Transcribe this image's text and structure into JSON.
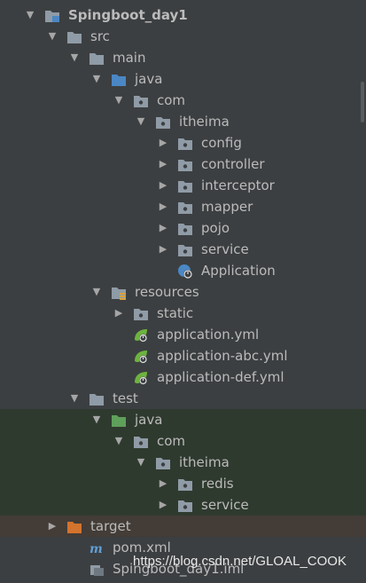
{
  "tree": [
    {
      "label": "Spingboot_day1",
      "icon": "module-folder-icon",
      "arrow": "expanded",
      "depth": 0,
      "bold": true
    },
    {
      "label": "src",
      "icon": "folder-icon",
      "arrow": "expanded",
      "depth": 1
    },
    {
      "label": "main",
      "icon": "folder-icon",
      "arrow": "expanded",
      "depth": 2
    },
    {
      "label": "java",
      "icon": "source-folder-icon",
      "arrow": "expanded",
      "depth": 3
    },
    {
      "label": "com",
      "icon": "package-icon",
      "arrow": "expanded",
      "depth": 4
    },
    {
      "label": "itheima",
      "icon": "package-icon",
      "arrow": "expanded",
      "depth": 5
    },
    {
      "label": "config",
      "icon": "package-icon",
      "arrow": "collapsed",
      "depth": 6
    },
    {
      "label": "controller",
      "icon": "package-icon",
      "arrow": "collapsed",
      "depth": 6
    },
    {
      "label": "interceptor",
      "icon": "package-icon",
      "arrow": "collapsed",
      "depth": 6
    },
    {
      "label": "mapper",
      "icon": "package-icon",
      "arrow": "collapsed",
      "depth": 6
    },
    {
      "label": "pojo",
      "icon": "package-icon",
      "arrow": "collapsed",
      "depth": 6
    },
    {
      "label": "service",
      "icon": "package-icon",
      "arrow": "collapsed",
      "depth": 6
    },
    {
      "label": "Application",
      "icon": "spring-boot-class-icon",
      "arrow": "none",
      "depth": 6
    },
    {
      "label": "resources",
      "icon": "resources-folder-icon",
      "arrow": "expanded",
      "depth": 3
    },
    {
      "label": "static",
      "icon": "package-icon",
      "arrow": "collapsed",
      "depth": 4
    },
    {
      "label": "application.yml",
      "icon": "spring-yml-icon",
      "arrow": "none",
      "depth": 4
    },
    {
      "label": "application-abc.yml",
      "icon": "spring-yml-icon",
      "arrow": "none",
      "depth": 4
    },
    {
      "label": "application-def.yml",
      "icon": "spring-yml-icon",
      "arrow": "none",
      "depth": 4
    },
    {
      "label": "test",
      "icon": "folder-icon",
      "arrow": "expanded",
      "depth": 2
    },
    {
      "label": "java",
      "icon": "test-source-folder-icon",
      "arrow": "expanded",
      "depth": 3,
      "testbg": true
    },
    {
      "label": "com",
      "icon": "package-icon",
      "arrow": "expanded",
      "depth": 4,
      "testbg": true
    },
    {
      "label": "itheima",
      "icon": "package-icon",
      "arrow": "expanded",
      "depth": 5,
      "testbg": true
    },
    {
      "label": "redis",
      "icon": "package-icon",
      "arrow": "collapsed",
      "depth": 6,
      "testbg": true
    },
    {
      "label": "service",
      "icon": "package-icon",
      "arrow": "collapsed",
      "depth": 6,
      "testbg": true
    },
    {
      "label": "target",
      "icon": "excluded-folder-icon",
      "arrow": "collapsed",
      "depth": 1,
      "targetbg": true
    },
    {
      "label": "pom.xml",
      "icon": "maven-icon",
      "arrow": "none",
      "depth": 2
    },
    {
      "label": "Spingboot_day1.iml",
      "icon": "iml-file-icon",
      "arrow": "none",
      "depth": 2
    }
  ],
  "watermark": "https://blog.csdn.net/GLOAL_COOK",
  "colors": {
    "background": "#3c3f41",
    "text": "#bbbbbb",
    "folder": "#8f9ba6",
    "source_folder": "#4a87c4",
    "test_folder": "#5fa05a",
    "excluded_folder": "#d2732e",
    "spring": "#6db33f",
    "maven": "#5f9fd7"
  }
}
